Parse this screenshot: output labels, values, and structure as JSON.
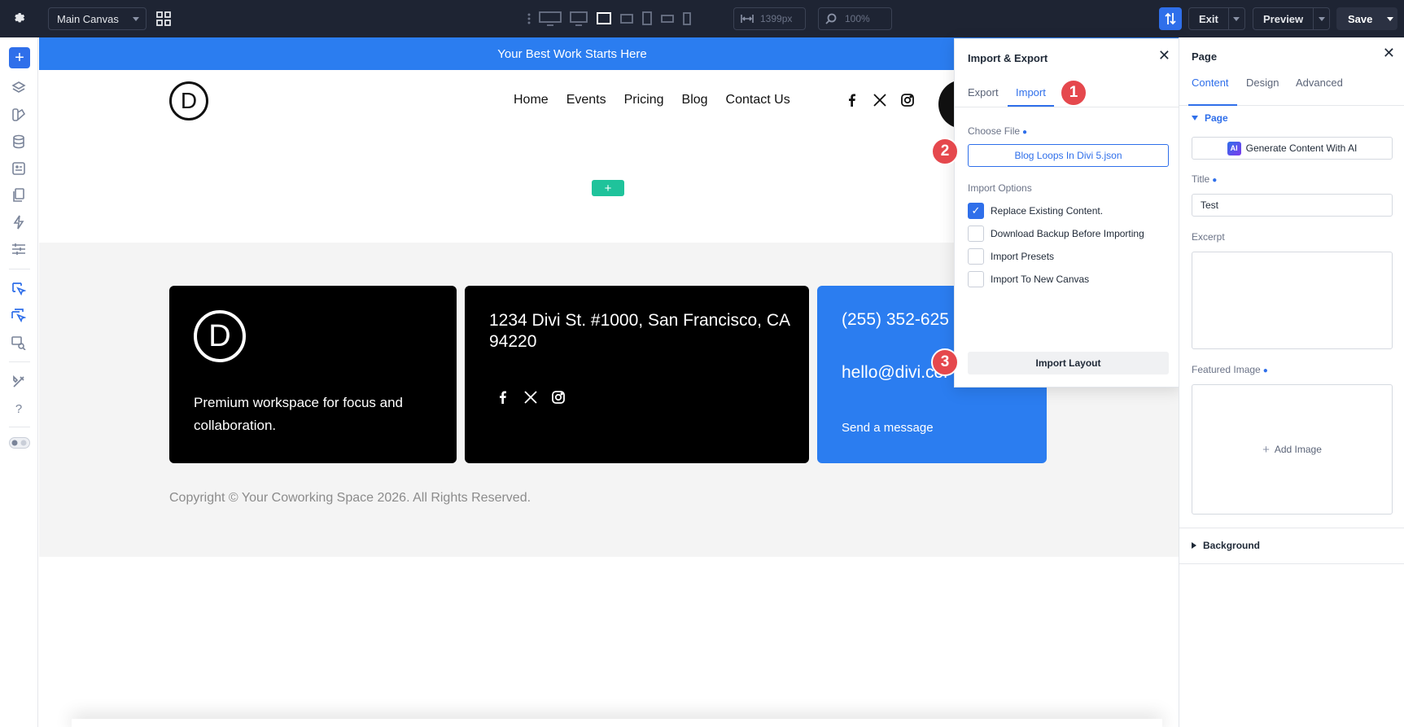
{
  "toolbar": {
    "canvas_select": "Main Canvas",
    "width_value": "1399px",
    "zoom_value": "100%",
    "exit_label": "Exit",
    "preview_label": "Preview",
    "save_label": "Save"
  },
  "canvas": {
    "banner_text": "Your Best Work Starts Here",
    "logo_letter": "D",
    "nav": [
      "Home",
      "Events",
      "Pricing",
      "Blog",
      "Contact Us"
    ],
    "footer": {
      "tagline": "Premium workspace for focus and collaboration.",
      "address": "1234 Divi St. #1000, San Francisco, CA 94220",
      "phone": "(255) 352-625",
      "email": "hello@divi.cor",
      "send_message": "Send a message",
      "copyright": "Copyright © Your Coworking Space 2026. All Rights Reserved."
    }
  },
  "import_export": {
    "title": "Import & Export",
    "tabs": [
      "Export",
      "Import"
    ],
    "active_tab": "Import",
    "choose_file_label": "Choose File",
    "file_name": "Blog Loops In Divi 5.json",
    "import_options_label": "Import Options",
    "options": [
      {
        "label": "Replace Existing Content.",
        "checked": true
      },
      {
        "label": "Download Backup Before Importing",
        "checked": false
      },
      {
        "label": "Import Presets",
        "checked": false
      },
      {
        "label": "Import To New Canvas",
        "checked": false
      }
    ],
    "import_button": "Import Layout",
    "step_badges": [
      "1",
      "2",
      "3"
    ]
  },
  "page_panel": {
    "title": "Page",
    "tabs": [
      "Content",
      "Design",
      "Advanced"
    ],
    "active_tab": "Content",
    "section_page": "Page",
    "ai_button": "Generate Content With AI",
    "ai_badge": "AI",
    "title_label": "Title",
    "title_value": "Test",
    "excerpt_label": "Excerpt",
    "featured_image_label": "Featured Image",
    "add_image": "Add Image",
    "section_background": "Background"
  },
  "colors": {
    "accent": "#2f6fea",
    "banner": "#2b7df0",
    "badge": "#e5484d",
    "add_row": "#1fc39b"
  }
}
